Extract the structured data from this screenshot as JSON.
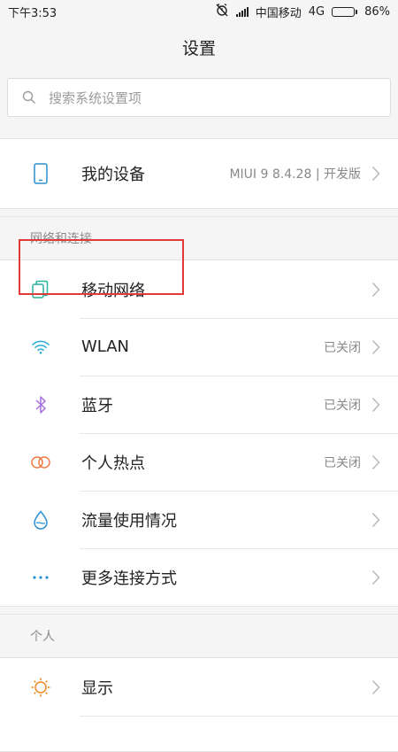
{
  "status_bar": {
    "time": "下午3:53",
    "carrier": "中国移动",
    "network": "4G",
    "battery": "86%",
    "battery_level": 0.86
  },
  "header": {
    "title": "设置"
  },
  "search": {
    "placeholder": "搜索系统设置项"
  },
  "device": {
    "label": "我的设备",
    "value": "MIUI 9 8.4.28 | 开发版",
    "icon": "phone-icon"
  },
  "sections": {
    "network_title": "网络和连接",
    "personal_title": "个人"
  },
  "network_items": [
    {
      "label": "移动网络",
      "value": "",
      "icon": "sim-card-icon",
      "color": "#2bb2a0"
    },
    {
      "label": "WLAN",
      "value": "已关闭",
      "icon": "wifi-icon",
      "color": "#2aa9d6"
    },
    {
      "label": "蓝牙",
      "value": "已关闭",
      "icon": "bluetooth-icon",
      "color": "#a86ee0"
    },
    {
      "label": "个人热点",
      "value": "已关闭",
      "icon": "hotspot-icon",
      "color": "#f07a45"
    },
    {
      "label": "流量使用情况",
      "value": "",
      "icon": "data-usage-icon",
      "color": "#2a8fd0"
    },
    {
      "label": "更多连接方式",
      "value": "",
      "icon": "more-dots-icon",
      "color": "#2a8fd0"
    }
  ],
  "personal_items": [
    {
      "label": "显示",
      "value": "",
      "icon": "brightness-icon",
      "color": "#f0891f"
    }
  ]
}
